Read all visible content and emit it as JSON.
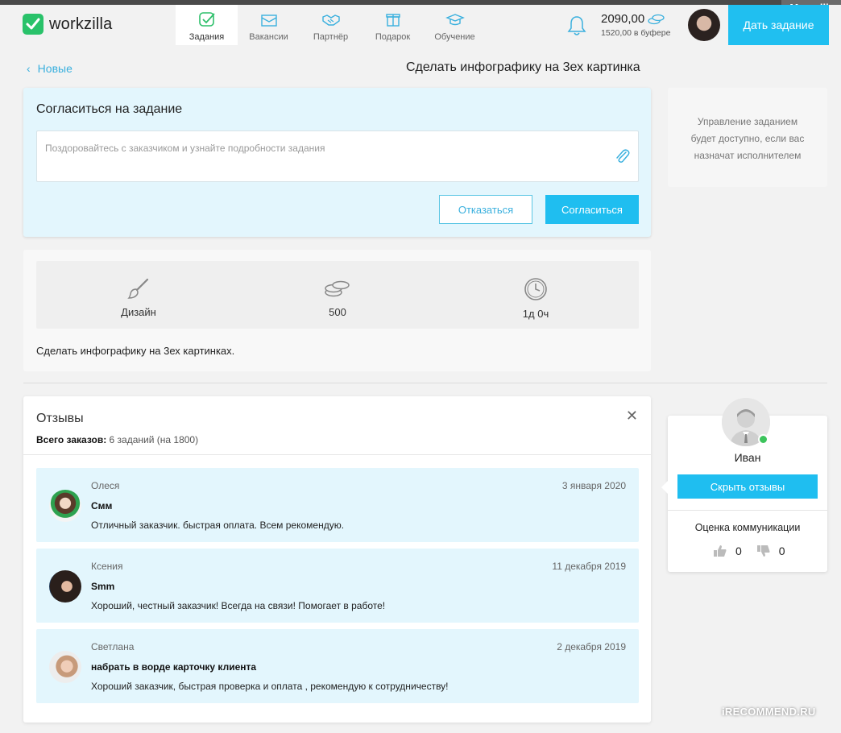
{
  "header": {
    "logo_text": "workzilla",
    "nav": [
      {
        "label": "Задания",
        "icon": "tasks-icon",
        "active": true
      },
      {
        "label": "Вакансии",
        "icon": "mail-icon",
        "active": false
      },
      {
        "label": "Партнёр",
        "icon": "handshake-icon",
        "active": false
      },
      {
        "label": "Подарок",
        "icon": "gift-icon",
        "active": false
      },
      {
        "label": "Обучение",
        "icon": "graduation-cap-icon",
        "active": false
      }
    ],
    "balance": "2090,00",
    "buffer": "1520,00 в буфере",
    "cta_label": "Дать задание",
    "accent": "#20bff0"
  },
  "watermark_user": "Mervallia",
  "breadcrumb": {
    "back_label": "Новые"
  },
  "page_title": "Сделать инфографику на 3ех картинка",
  "accept": {
    "title": "Согласиться на задание",
    "placeholder": "Поздоровайтесь с заказчиком и узнайте подробности задания",
    "decline_label": "Отказаться",
    "accept_label": "Согласиться"
  },
  "side_note": {
    "line1": "Управление заданием",
    "line2": "будет доступно, если вас",
    "line3": "назначат исполнителем"
  },
  "details": {
    "category": "Дизайн",
    "price": "500",
    "duration": "1д 0ч",
    "description": "Сделать инфографику на 3ех картинках."
  },
  "reviews": {
    "title": "Отзывы",
    "total_label": "Всего заказов:",
    "total_value": "6 заданий (на 1800)",
    "items": [
      {
        "name": "Олеся",
        "date": "3 января 2020",
        "task": "Смм",
        "text": "Отличный заказчик. быстрая оплата. Всем рекомендую."
      },
      {
        "name": "Ксения",
        "date": "11 декабря 2019",
        "task": "Smm",
        "text": "Хороший, честный заказчик! Всегда на связи! Помогает в работе!"
      },
      {
        "name": "Светлана",
        "date": "2 декабря 2019",
        "task": "набрать в ворде карточку клиента",
        "text": "Хороший заказчик, быстрая проверка и оплата , рекомендую к сотрудничеству!"
      }
    ]
  },
  "user": {
    "name": "Иван",
    "hide_label": "Скрыть отзывы",
    "comm_label": "Оценка коммуникации",
    "likes": "0",
    "dislikes": "0"
  },
  "watermark_bottom": "iRECOMMEND.RU"
}
